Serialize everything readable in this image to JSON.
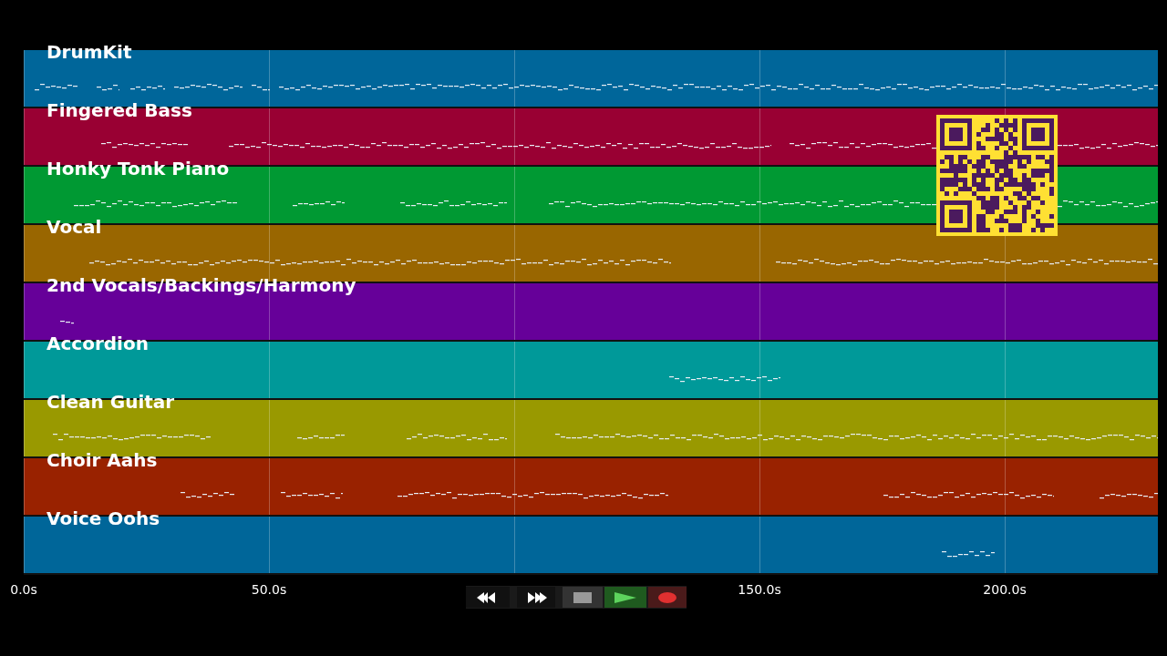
{
  "tracks": [
    {
      "name": "DrumKit",
      "color": "#00669a"
    },
    {
      "name": "Fingered Bass",
      "color": "#990033"
    },
    {
      "name": "Honky Tonk Piano",
      "color": "#009933"
    },
    {
      "name": "Vocal",
      "color": "#996600"
    },
    {
      "name": "2nd Vocals/Backings/Harmony",
      "color": "#660099"
    },
    {
      "name": "Accordion",
      "color": "#009999"
    },
    {
      "name": "Clean Guitar",
      "color": "#999900"
    },
    {
      "name": "Choir Aahs",
      "color": "#992200"
    },
    {
      "name": "Voice Oohs",
      "color": "#006699"
    }
  ],
  "timeline": {
    "ticks": [
      {
        "label": "0.0s"
      },
      {
        "label": "50.0s"
      },
      {
        "label": "150.0s"
      },
      {
        "label": "200.0s"
      }
    ]
  },
  "transport": [
    {
      "kind": "rewind"
    },
    {
      "kind": "forward"
    },
    {
      "kind": "stop"
    },
    {
      "kind": "play"
    },
    {
      "kind": "record"
    }
  ]
}
